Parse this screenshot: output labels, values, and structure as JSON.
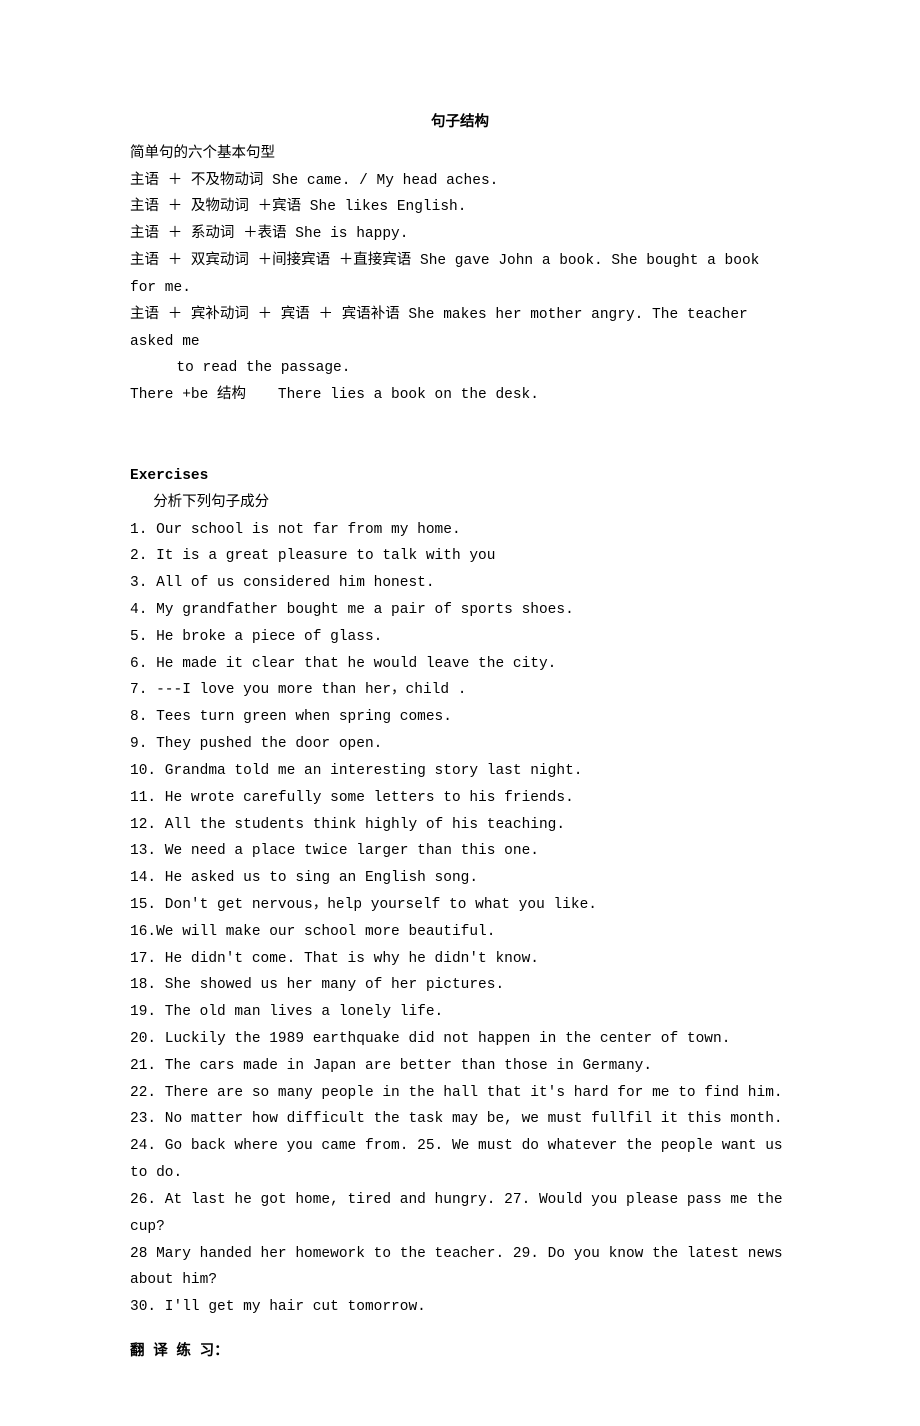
{
  "title": "句子结构",
  "intro": {
    "heading": "简单句的六个基本句型",
    "patterns": [
      "主语 ＋ 不及物动词 She came. / My head aches.",
      "主语 ＋ 及物动词 ＋宾语 She likes English.",
      "主语 ＋ 系动词 ＋表语 She is happy.",
      "主语 ＋ 双宾动词 ＋间接宾语 ＋直接宾语 She gave John a book. She bought a book for me.",
      "主语 ＋ 宾补动词 ＋ 宾语 ＋ 宾语补语 She makes her mother angry. The teacher asked me",
      "to read the passage."
    ],
    "there_left": "There +be 结构",
    "there_right": "There lies a book on the desk."
  },
  "exercises": {
    "heading": "Exercises",
    "sub": "分析下列句子成分",
    "items": [
      "1. Our school is not far from my home.",
      "2. It is a great pleasure to talk with you",
      "3. All of us considered him honest.",
      "4. My grandfather bought me a pair of sports shoes.",
      "5. He broke a piece of glass.",
      "6. He made it clear that he would leave the city.",
      "7. ---I love you more than her，child .",
      "8. Tees turn green when spring comes.",
      "9. They pushed the door open.",
      "10. Grandma told me an interesting story last night.",
      "11. He wrote carefully some letters to his friends.",
      "12. All the students think highly of his teaching.",
      "13. We need a place twice larger than this one.",
      "14. He asked us to sing an English song.",
      "15. Don't get nervous，help yourself to what you like.",
      "16.We will make our school more beautiful.",
      "17. He didn't come. That is why he didn't know.",
      "18. She showed us her many of her pictures.",
      "19. The old man lives a lonely life.",
      "20. Luckily the 1989 earthquake did not happen in the center of town.",
      "21. The cars made in Japan are better than those in Germany.",
      "22. There are so many people in the hall that it's hard for me to find him.",
      "23. No matter how difficult the task may be, we must fullfil it this month.",
      "24. Go back where you came from. 25. We must do whatever the people want us to do.",
      "26. At last he got home, tired and hungry. 27. Would you please pass me the cup?",
      "28 Mary handed her homework to the teacher. 29. Do you know the latest news about him?",
      "30. I'll get my hair cut tomorrow."
    ]
  },
  "translate": {
    "heading": "翻 译 练 习："
  }
}
